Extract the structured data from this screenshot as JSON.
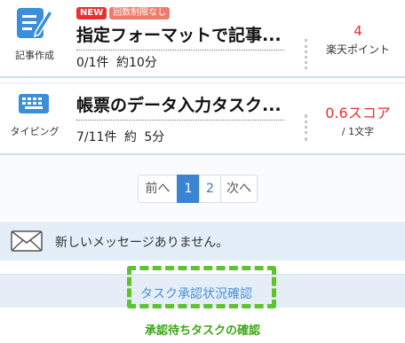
{
  "tasks": [
    {
      "icon": "article-writing-icon",
      "category": "記事作成",
      "badge_new": "NEW",
      "badge_unlimited": "回数制限なし",
      "title": "指定フォーマットで記事...",
      "progress": "0/1件",
      "duration": "約10分",
      "reward_value": "4",
      "reward_unit": "楽天ポイント"
    },
    {
      "icon": "keyboard-icon",
      "category": "タイピング",
      "title": "帳票のデータ入力タスク...",
      "progress": "7/11件",
      "duration": "約 5分",
      "reward_value": "0.6スコア",
      "reward_unit": "/ 1文字"
    }
  ],
  "pagination": {
    "prev": "前へ",
    "pages": [
      "1",
      "2"
    ],
    "current": "1",
    "next": "次へ"
  },
  "message": {
    "text": "新しいメッセージありません。"
  },
  "approval": {
    "link": "タスク承認状況確認"
  },
  "caption": "承認待ちタスクの確認",
  "colors": {
    "accent_blue": "#3c84d2",
    "reward_red": "#e8312f",
    "highlight_green": "#5ec32e"
  }
}
